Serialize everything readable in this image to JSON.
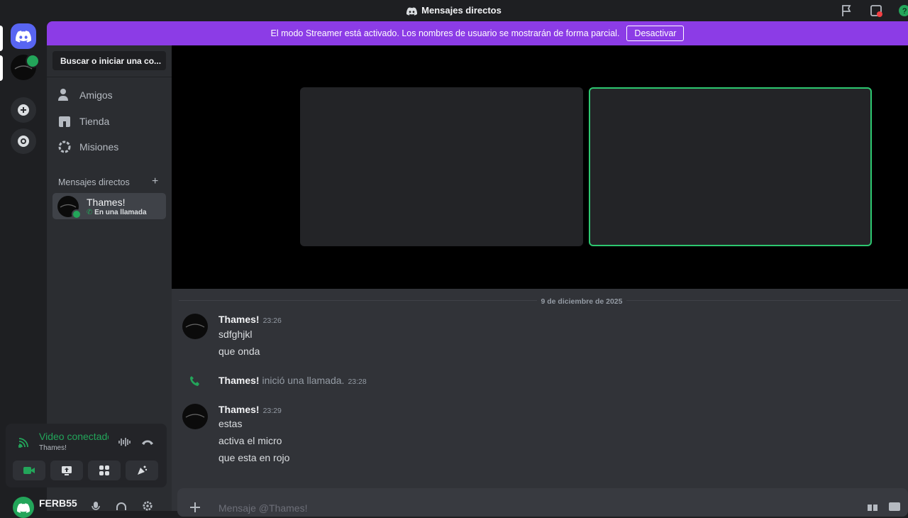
{
  "window": {
    "title": "Mensajes directos"
  },
  "banner": {
    "text": "El modo Streamer está activado. Los nombres de usuario se mostrarán de forma parcial.",
    "button_label": "Desactivar"
  },
  "sidebar": {
    "search_placeholder": "Buscar o iniciar una co...",
    "nav": [
      {
        "label": "Amigos",
        "icon": "friends-icon"
      },
      {
        "label": "Tienda",
        "icon": "shop-icon"
      },
      {
        "label": "Misiones",
        "icon": "quests-icon"
      }
    ],
    "dm_header": "Mensajes directos",
    "dm_add": "+",
    "dms": [
      {
        "name": "Thames!",
        "status": "En una llamada"
      }
    ]
  },
  "voice_panel": {
    "title": "Video conectado",
    "subtitle": "Thames!"
  },
  "user": {
    "name": "FERB55"
  },
  "chat": {
    "date_divider": "9 de diciembre de 2025",
    "groups": [
      {
        "author": "Thames!",
        "time": "23:26",
        "lines": [
          "sdfghjkl",
          "que onda"
        ]
      },
      {
        "author": "Thames!",
        "time": "23:29",
        "lines": [
          "estas",
          "activa el micro",
          "que esta en rojo"
        ]
      }
    ],
    "system": {
      "author": "Thames!",
      "text": "inició una llamada.",
      "time": "23:28"
    },
    "composer_placeholder": "Mensaje @Thames!"
  },
  "colors": {
    "banner": "#8c3ce6",
    "accent": "#5865f2",
    "online": "#23a55a",
    "speaking_border": "#2dc770"
  }
}
